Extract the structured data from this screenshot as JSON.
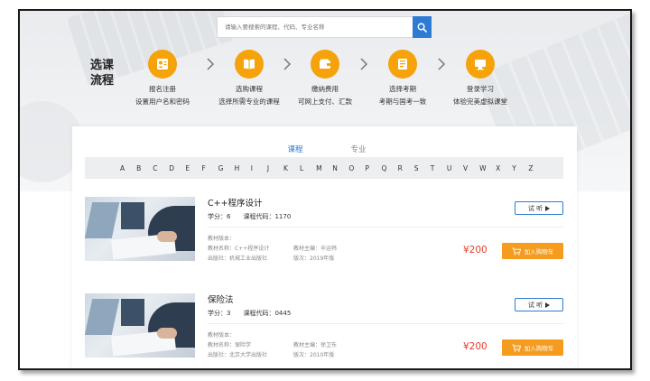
{
  "search": {
    "placeholder": "请输入要搜索的课程、代码、专业名称"
  },
  "process": {
    "title": "选课流程",
    "steps": [
      {
        "icon": "user-card-icon",
        "line1": "报名注册",
        "line2": "设置用户名和密码"
      },
      {
        "icon": "book-icon",
        "line1": "选购课程",
        "line2": "选择所需专业的课程"
      },
      {
        "icon": "wallet-icon",
        "line1": "缴纳费用",
        "line2": "可网上支付、汇款"
      },
      {
        "icon": "exam-doc-icon",
        "line1": "选择考期",
        "line2": "考期与国考一致"
      },
      {
        "icon": "monitor-icon",
        "line1": "登录学习",
        "line2": "体验完美虚拟课堂"
      }
    ]
  },
  "tabs": [
    {
      "label": "课程",
      "active": true
    },
    {
      "label": "专业",
      "active": false
    }
  ],
  "alphabet": [
    "A",
    "B",
    "C",
    "D",
    "E",
    "F",
    "G",
    "H",
    "I",
    "J",
    "K",
    "L",
    "M",
    "N",
    "O",
    "P",
    "Q",
    "R",
    "S",
    "T",
    "U",
    "V",
    "W",
    "X",
    "Y",
    "Z"
  ],
  "courses": [
    {
      "name": "C++程序设计",
      "credit_label": "学分：",
      "credit": "6",
      "code_label": "课程代码：",
      "code": "1170",
      "edition_label": "教材版本：",
      "textbook_label": "教材名称：",
      "textbook": "C++程序设计",
      "editor_label": "教材主编：",
      "editor": "辛运帏",
      "publisher_label": "出版社：",
      "publisher": "机械工业出版社",
      "version_label": "版次：",
      "version": "2019年版",
      "price": "¥200",
      "trial": "试 听",
      "cart": "加入购物车"
    },
    {
      "name": "保险法",
      "credit_label": "学分：",
      "credit": "3",
      "code_label": "课程代码：",
      "code": "0445",
      "edition_label": "教材版本：",
      "textbook_label": "教材名称：",
      "textbook": "保险学",
      "editor_label": "教材主编：",
      "editor": "徐卫东",
      "publisher_label": "出版社：",
      "publisher": "北京大学出版社",
      "version_label": "版次：",
      "version": "2010年版",
      "price": "¥200",
      "trial": "试 听",
      "cart": "加入购物车"
    }
  ],
  "colors": {
    "accent": "#2d7bd3",
    "orange": "#f6a20a",
    "price": "#e83c2d",
    "cart": "#f59b1e"
  }
}
